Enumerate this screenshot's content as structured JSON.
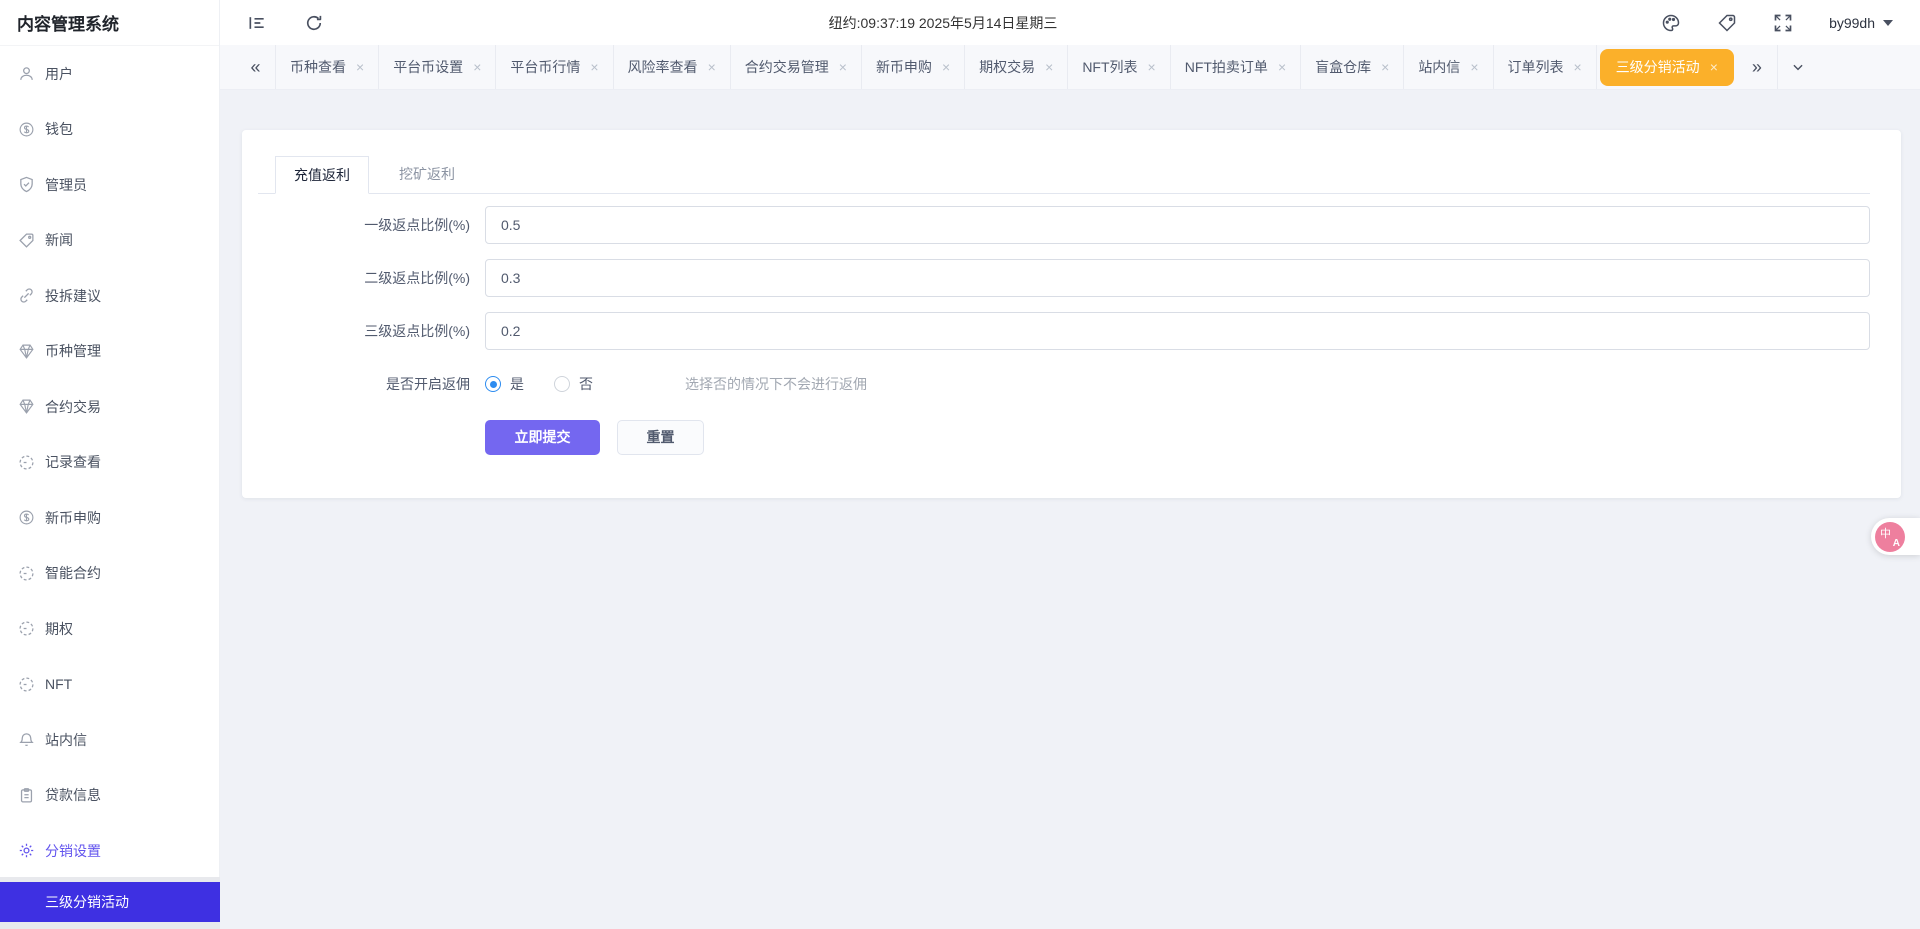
{
  "app": {
    "title": "内容管理系统",
    "clock": "纽约:09:37:19 2025年5月14日星期三",
    "username": "by99dh"
  },
  "icons": {
    "close": "×",
    "scroll_left": "«",
    "scroll_right": "»",
    "topbar": [
      "sidebar-fold-icon",
      "refresh-icon",
      "palette-icon",
      "tag-icon",
      "fullscreen-icon",
      "caret-down-icon"
    ],
    "translate_badge": "translate-icon"
  },
  "sidebar": {
    "items": [
      {
        "icon": "user-icon",
        "label": "用户"
      },
      {
        "icon": "wallet-dollar-icon",
        "label": "钱包"
      },
      {
        "icon": "shield-check-icon",
        "label": "管理员"
      },
      {
        "icon": "tag-icon",
        "label": "新闻"
      },
      {
        "icon": "link-icon",
        "label": "投拆建议"
      },
      {
        "icon": "gem-icon",
        "label": "币种管理"
      },
      {
        "icon": "gem-icon",
        "label": "合约交易"
      },
      {
        "icon": "dashed-circle-icon",
        "label": "记录查看"
      },
      {
        "icon": "dollar-circle-icon",
        "label": "新币申购"
      },
      {
        "icon": "dashed-circle-icon",
        "label": "智能合约"
      },
      {
        "icon": "dashed-circle-icon",
        "label": "期权"
      },
      {
        "icon": "dashed-circle-icon",
        "label": "NFT"
      },
      {
        "icon": "bell-icon",
        "label": "站内信"
      },
      {
        "icon": "clipboard-icon",
        "label": "贷款信息"
      },
      {
        "icon": "gear-icon",
        "label": "分销设置"
      }
    ],
    "active_item": "分销设置",
    "submenu_item": "三级分销活动"
  },
  "tabbar": {
    "tabs": [
      {
        "label": "币种查看"
      },
      {
        "label": "平台币设置"
      },
      {
        "label": "平台币行情"
      },
      {
        "label": "风险率查看"
      },
      {
        "label": "合约交易管理"
      },
      {
        "label": "新币申购"
      },
      {
        "label": "期权交易"
      },
      {
        "label": "NFT列表"
      },
      {
        "label": "NFT拍卖订单"
      },
      {
        "label": "盲盒仓库"
      },
      {
        "label": "站内信"
      },
      {
        "label": "订单列表"
      },
      {
        "label": "三级分销活动"
      }
    ],
    "active_tab": "三级分销活动",
    "active_tab_color": "#fbb02a"
  },
  "content": {
    "tabs": [
      {
        "label": "充值返利",
        "active": true
      },
      {
        "label": "挖矿返利",
        "active": false
      }
    ],
    "form": {
      "fields": [
        {
          "label": "一级返点比例(%)",
          "value": "0.5"
        },
        {
          "label": "二级返点比例(%)",
          "value": "0.3"
        },
        {
          "label": "三级返点比例(%)",
          "value": "0.2"
        }
      ],
      "radio": {
        "label": "是否开启返佣",
        "options": [
          "是",
          "否"
        ],
        "selected": "是",
        "hint": "选择否的情况下不会进行返佣"
      },
      "buttons": {
        "submit": "立即提交",
        "reset": "重置"
      }
    }
  },
  "badge": {
    "zh": "中",
    "en": "A"
  },
  "colors": {
    "primary_button": "#7467f0",
    "sidebar_active": "#6355ee",
    "submenu_bg": "#3e30e2",
    "active_tab_bg": "#fbb02a",
    "radio_checked": "#2d8cf0",
    "page_bg": "#f0f2f7",
    "badge_pink": "#ee7f9e"
  }
}
